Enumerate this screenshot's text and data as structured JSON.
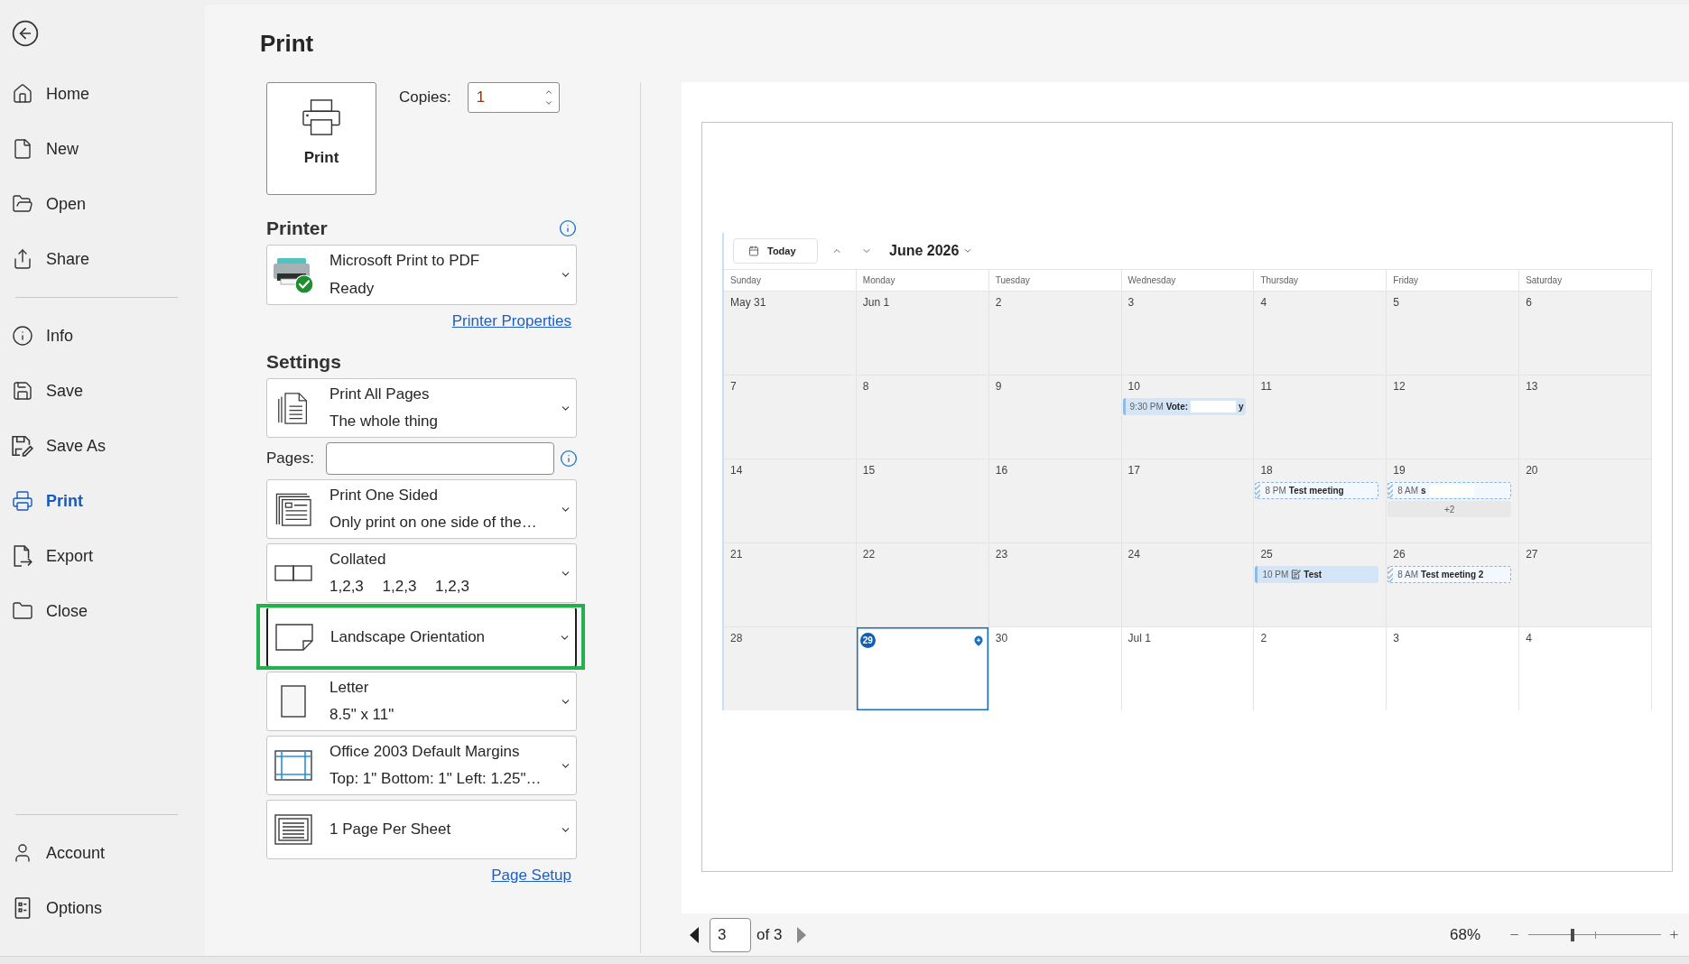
{
  "sidebar": {
    "groups": [
      {
        "items": [
          {
            "label": "Home",
            "selected": false
          },
          {
            "label": "New",
            "selected": false
          },
          {
            "label": "Open",
            "selected": false
          },
          {
            "label": "Share",
            "selected": false
          }
        ]
      },
      {
        "items": [
          {
            "label": "Info",
            "selected": false
          },
          {
            "label": "Save",
            "selected": false
          },
          {
            "label": "Save As",
            "selected": false
          },
          {
            "label": "Print",
            "selected": true
          },
          {
            "label": "Export",
            "selected": false
          },
          {
            "label": "Close",
            "selected": false
          }
        ]
      }
    ],
    "footer_items": [
      {
        "label": "Account",
        "selected": false
      },
      {
        "label": "Options",
        "selected": false
      }
    ]
  },
  "title": "Print",
  "print_button": {
    "label": "Print"
  },
  "copies": {
    "label": "Copies:",
    "value": "1"
  },
  "printer": {
    "heading": "Printer",
    "name": "Microsoft Print to PDF",
    "status": "Ready",
    "properties_link": "Printer Properties"
  },
  "settings": {
    "heading": "Settings",
    "items": [
      {
        "kind": "range",
        "title": "Print All Pages",
        "subtitle": "The whole thing",
        "highlighted": false
      },
      {
        "kind": "pages_field",
        "label": "Pages:",
        "highlighted": false
      },
      {
        "kind": "sides",
        "title": "Print One Sided",
        "subtitle": "Only print on one side of the…",
        "highlighted": false
      },
      {
        "kind": "collation",
        "title": "Collated",
        "subtitle": "1,2,3 1,2,3 1,2,3",
        "highlighted": false
      },
      {
        "kind": "orientation",
        "title": "Landscape Orientation",
        "highlighted": true
      },
      {
        "kind": "paper",
        "title": "Letter",
        "subtitle": "8.5\" x 11\"",
        "highlighted": false
      },
      {
        "kind": "margins",
        "title": "Office 2003 Default Margins",
        "subtitle": "Top: 1\" Bottom: 1\" Left: 1.25\"…",
        "highlighted": false
      },
      {
        "kind": "per_sheet",
        "title": "1 Page Per Sheet",
        "highlighted": false
      }
    ],
    "page_setup_link": "Page Setup"
  },
  "preview": {
    "calendar": {
      "today_button": "Today",
      "month": "June 2026",
      "weekdays": [
        "Sunday",
        "Monday",
        "Tuesday",
        "Wednesday",
        "Thursday",
        "Friday",
        "Saturday"
      ],
      "weeks": [
        {
          "days": [
            {
              "label": "May 31",
              "past": true,
              "today": false
            },
            {
              "label": "Jun 1",
              "past": true,
              "today": false
            },
            {
              "label": "2",
              "past": true,
              "today": false
            },
            {
              "label": "3",
              "past": true,
              "today": false
            },
            {
              "label": "4",
              "past": true,
              "today": false
            },
            {
              "label": "5",
              "past": true,
              "today": false
            },
            {
              "label": "6",
              "past": true,
              "today": false
            }
          ]
        },
        {
          "days": [
            {
              "label": "7",
              "past": true,
              "today": false
            },
            {
              "label": "8",
              "past": true,
              "today": false
            },
            {
              "label": "9",
              "past": true,
              "today": false
            },
            {
              "label": "10",
              "past": true,
              "today": false,
              "events": [
                {
                  "kind": "busy",
                  "time": "9:30 PM",
                  "title": "Vote:",
                  "redacted": true,
                  "title_tail": "y",
                  "note": false
                }
              ]
            },
            {
              "label": "11",
              "past": true,
              "today": false
            },
            {
              "label": "12",
              "past": true,
              "today": false
            },
            {
              "label": "13",
              "past": true,
              "today": false
            }
          ]
        },
        {
          "days": [
            {
              "label": "14",
              "past": true,
              "today": false
            },
            {
              "label": "15",
              "past": true,
              "today": false
            },
            {
              "label": "16",
              "past": true,
              "today": false
            },
            {
              "label": "17",
              "past": true,
              "today": false
            },
            {
              "label": "18",
              "past": true,
              "today": false,
              "events": [
                {
                  "kind": "tentative",
                  "time": "8 PM",
                  "title": "Test meeting",
                  "redacted": false,
                  "note": false
                }
              ]
            },
            {
              "label": "19",
              "past": true,
              "today": false,
              "events": [
                {
                  "kind": "tentative",
                  "time": "8 AM",
                  "title": "s",
                  "redacted": true,
                  "note": false
                }
              ],
              "more": "+2"
            },
            {
              "label": "20",
              "past": true,
              "today": false
            }
          ]
        },
        {
          "days": [
            {
              "label": "21",
              "past": true,
              "today": false
            },
            {
              "label": "22",
              "past": true,
              "today": false
            },
            {
              "label": "23",
              "past": true,
              "today": false
            },
            {
              "label": "24",
              "past": true,
              "today": false
            },
            {
              "label": "25",
              "past": true,
              "today": false,
              "events": [
                {
                  "kind": "busy",
                  "time": "10 PM",
                  "title": "Test",
                  "redacted": false,
                  "note": true
                }
              ]
            },
            {
              "label": "26",
              "past": true,
              "today": false,
              "events": [
                {
                  "kind": "tentative",
                  "time": "8 AM",
                  "title": "Test meeting 2",
                  "redacted": false,
                  "note": false
                }
              ]
            },
            {
              "label": "27",
              "past": true,
              "today": false
            }
          ]
        },
        {
          "days": [
            {
              "label": "28",
              "past": true,
              "today": false
            },
            {
              "label": "29",
              "past": false,
              "today": true
            },
            {
              "label": "30",
              "past": false,
              "today": false
            },
            {
              "label": "Jul 1",
              "past": false,
              "today": false
            },
            {
              "label": "2",
              "past": false,
              "today": false
            },
            {
              "label": "3",
              "past": false,
              "today": false
            },
            {
              "label": "4",
              "past": false,
              "today": false
            }
          ]
        }
      ]
    },
    "page_nav": {
      "page": "3",
      "total": "of 3"
    },
    "zoom": {
      "value": "68%",
      "level": 0.33
    }
  }
}
